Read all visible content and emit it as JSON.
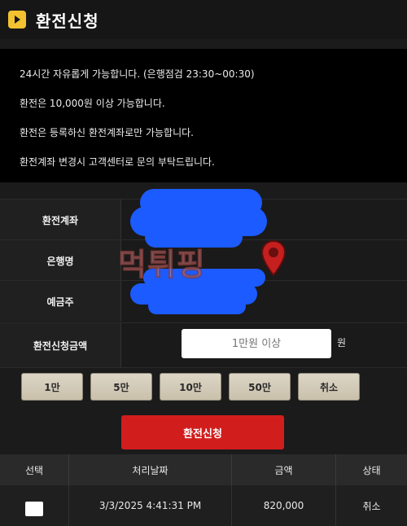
{
  "header": {
    "title": "환전신청",
    "icon": "play-icon"
  },
  "notice": {
    "lines": [
      "24시간 자유롭게 가능합니다. (은행점검 23:30~00:30)",
      "환전은 10,000원 이상 가능합니다.",
      "환전은 등록하신 환전계좌로만 가능합니다.",
      "환전계좌 변경시 고객센터로 문의 부탁드립니다."
    ]
  },
  "form": {
    "account_label": "환전계좌",
    "bank_label": "은행명",
    "holder_label": "예금주",
    "amount_label": "환전신청금액",
    "amount_placeholder": "1만원 이상",
    "amount_unit": "원"
  },
  "quick_buttons": [
    "1만",
    "5만",
    "10만",
    "50만",
    "취소"
  ],
  "submit_label": "환전신청",
  "table": {
    "headers": [
      "선택",
      "처리날짜",
      "금액",
      "상태"
    ],
    "rows": [
      {
        "date": "3/3/2025 4:41:31 PM",
        "amount": "820,000",
        "status": "취소"
      }
    ]
  },
  "watermark": {
    "text": "먹튀핑"
  },
  "colors": {
    "background": "#1b1b1b",
    "accent_yellow": "#f2c230",
    "submit_red": "#d21d1d",
    "redaction_blue": "#1c5bff"
  }
}
